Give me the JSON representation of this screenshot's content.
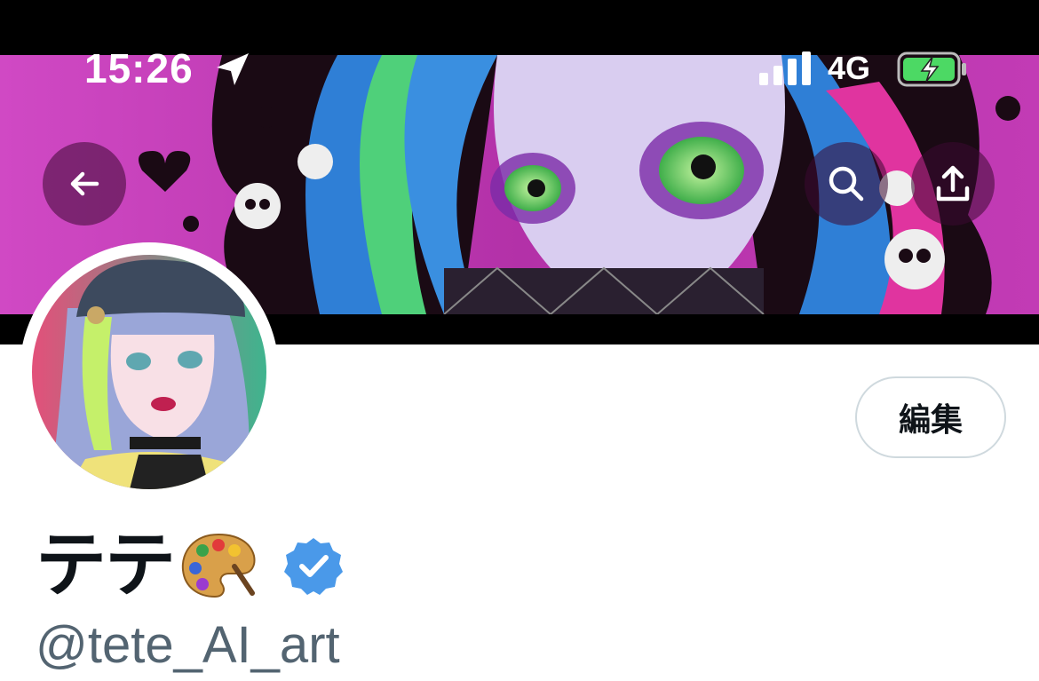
{
  "status_bar": {
    "time": "15:26",
    "network": "4G",
    "icons": [
      "location-arrow-icon",
      "cellular-signal-icon",
      "battery-charging-icon"
    ]
  },
  "header": {
    "buttons": [
      "back-arrow-icon",
      "search-icon",
      "share-icon"
    ]
  },
  "profile": {
    "display_name": "テテ",
    "name_emoji": "artist-palette-icon",
    "verified_badge": "verified-check-icon",
    "handle": "@tete_AI_art",
    "edit_button_label": "編集"
  },
  "colors": {
    "banner_magenta": "#c23bb5",
    "verified_blue": "#4a99e9",
    "handle_gray": "#536471",
    "battery_green": "#4cd964"
  }
}
